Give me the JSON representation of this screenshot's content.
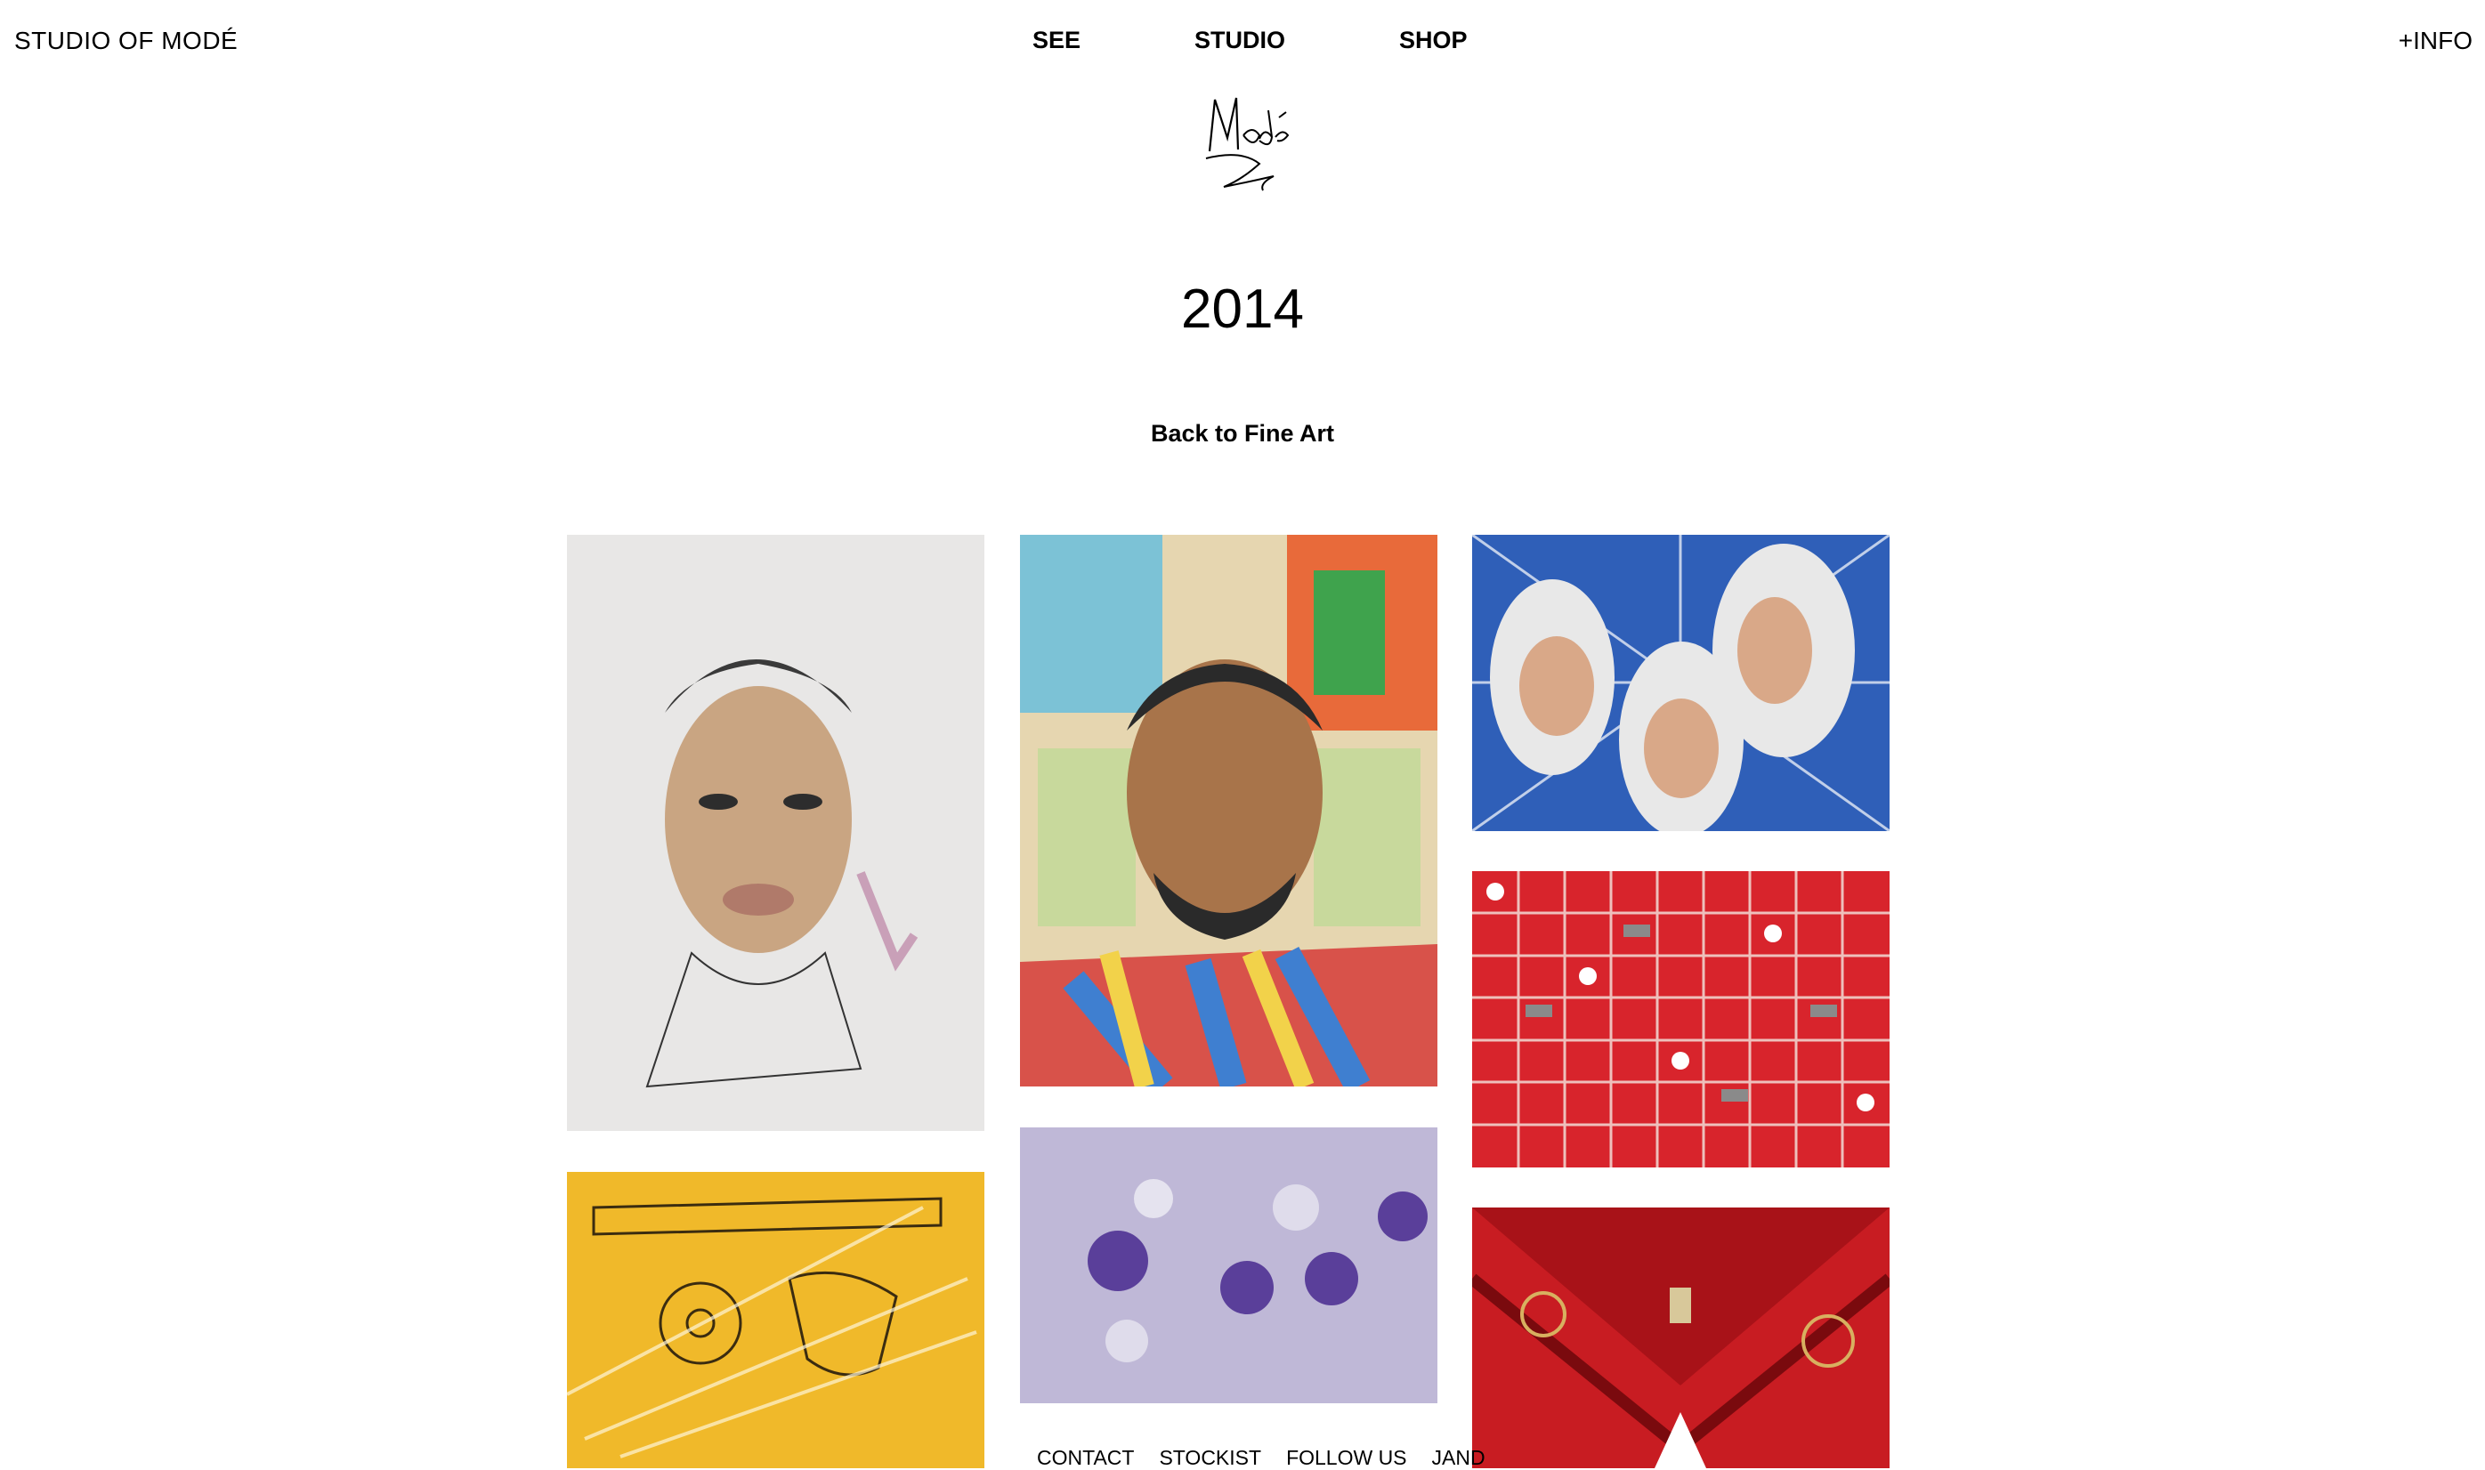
{
  "header": {
    "site_name": "STUDIO OF MODÉ",
    "nav": [
      "SEE",
      "STUDIO",
      "SHOP"
    ],
    "info_link": "+INFO"
  },
  "logo_icon": "mode-signature-logo",
  "page": {
    "title": "2014",
    "back_link": "Back to Fine Art"
  },
  "gallery": {
    "items": [
      {
        "name": "artwork-portrait-woman"
      },
      {
        "name": "artwork-portrait-man-colorful"
      },
      {
        "name": "artwork-blue-tiles-faces"
      },
      {
        "name": "artwork-red-grid-pistols"
      },
      {
        "name": "artwork-yellow-revolvers"
      },
      {
        "name": "artwork-purple-flowers"
      },
      {
        "name": "artwork-red-pattern"
      }
    ]
  },
  "footer": {
    "links": [
      "CONTACT",
      "STOCKIST",
      "FOLLOW US",
      "JAND"
    ]
  },
  "colors": {
    "text": "#000000",
    "background": "#ffffff"
  }
}
